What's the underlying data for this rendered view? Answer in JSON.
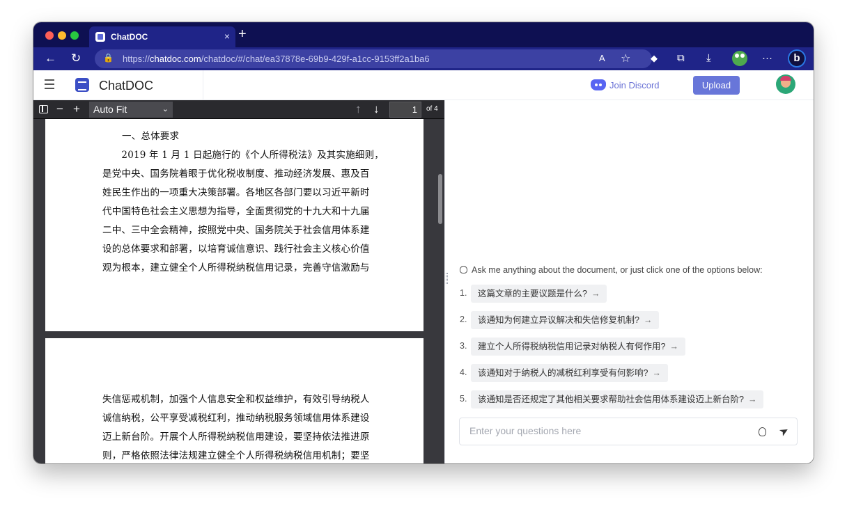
{
  "browser": {
    "tab_title": "ChatDOC",
    "tab_close": "×",
    "new_tab": "+",
    "url_prefix": "https://",
    "url_host": "chatdoc.com",
    "url_path": "/chatdoc/#/chat/ea37878e-69b9-429f-a1cc-9153ff2a1ba6",
    "back_icon": "←",
    "reload_icon": "↻",
    "lock_icon": "🔒",
    "read_aloud_icon": "A",
    "favorite_icon": "☆",
    "downloads_icon": "⤓",
    "more_icon": "···",
    "bing_label": "b"
  },
  "app": {
    "title": "ChatDOC",
    "discord_label": "Join Discord",
    "upload_label": "Upload"
  },
  "pdf": {
    "zoom_value": "Auto Fit",
    "page_number": "1",
    "page_total": "of 4",
    "minus_icon": "−",
    "plus_icon": "+",
    "prev_icon": "↑",
    "next_icon": "↓",
    "page1_lines": [
      "一、总体要求",
      "　　2019 年 1 月 1 日起施行的《个人所得税法》及其实施细则，",
      "是党中央、国务院着眼于优化税收制度、推动经济发展、惠及百",
      "姓民生作出的一项重大决策部署。各地区各部门要以习近平新时",
      "代中国特色社会主义思想为指导，全面贯彻党的十九大和十九届",
      "二中、三中全会精神，按照党中央、国务院关于社会信用体系建",
      "设的总体要求和部署，以培育诚信意识、践行社会主义核心价值",
      "观为根本，建立健全个人所得税纳税信用记录，完善守信激励与"
    ],
    "page2_lines": [
      "失信惩戒机制，加强个人信息安全和权益维护，有效引导纳税人",
      "诚信纳税，公平享受减税红利，推动纳税服务领域信用体系建设",
      "迈上新台阶。开展个人所得税纳税信用建设，要坚持依法推进原",
      "则，严格依照法律法规建立健全个人所得税纳税信用机制；要坚"
    ]
  },
  "chat": {
    "hint": "Ask me anything about the document, or just click one of the options below:",
    "suggestions": [
      {
        "num": "1.",
        "text": "这篇文章的主要议题是什么?"
      },
      {
        "num": "2.",
        "text": "该通知为何建立异议解决和失信修复机制?"
      },
      {
        "num": "3.",
        "text": "建立个人所得税纳税信用记录对纳税人有何作用?"
      },
      {
        "num": "4.",
        "text": "该通知对于纳税人的减税红利享受有何影响?"
      },
      {
        "num": "5.",
        "text": "该通知是否还规定了其他相关要求帮助社会信用体系建设迈上新台阶?"
      }
    ],
    "arrow": "→",
    "input_placeholder": "Enter your questions here",
    "send_icon": "➤"
  }
}
